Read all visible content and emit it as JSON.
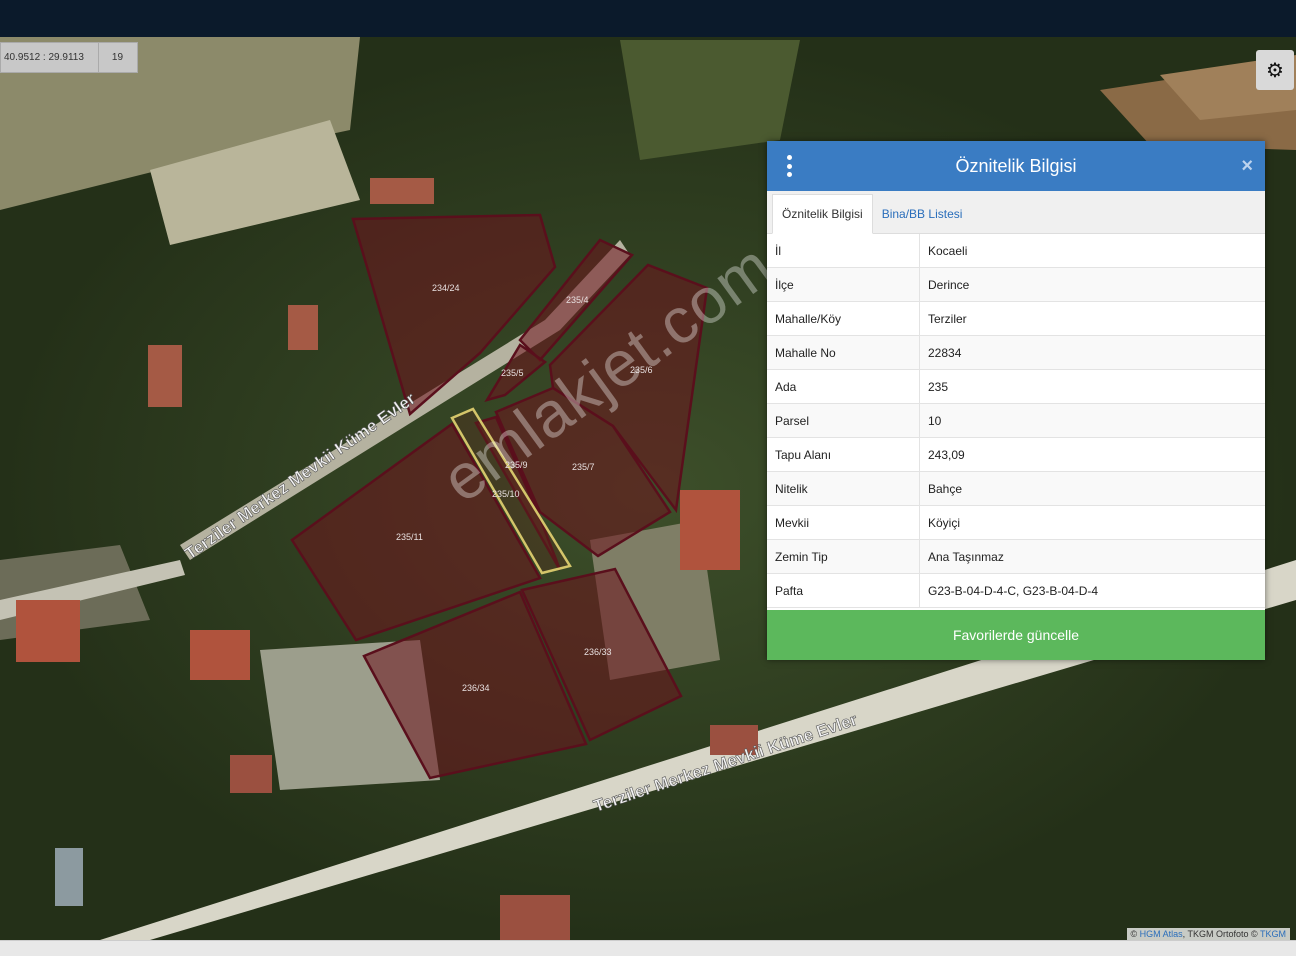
{
  "map": {
    "coordinates": "40.9512 : 29.9113",
    "zoom": "19",
    "settings_icon": "gear-icon",
    "road_labels": [
      "Terziler Merkez Mevkii Küme Evler",
      "Terziler Merkez Mevkii Küme Evler"
    ],
    "parcels": [
      "234/24",
      "235/4",
      "235/5",
      "235/6",
      "235/9",
      "235/7",
      "235/10",
      "235/11",
      "236/33",
      "236/34"
    ],
    "attribution": {
      "prefix": "©",
      "hgm": "HGM Atlas",
      "mid": ", TKGM Ortofoto ©",
      "tkgm": "TKGM"
    },
    "watermark": "emlakjet.com"
  },
  "panel": {
    "title": "Öznitelik Bilgisi",
    "menu_icon": "vertical-dots-icon",
    "close_icon": "close-icon",
    "tabs": [
      {
        "label": "Öznitelik Bilgisi",
        "active": true
      },
      {
        "label": "Bina/BB Listesi",
        "active": false
      }
    ],
    "rows": [
      {
        "key": "İl",
        "value": "Kocaeli"
      },
      {
        "key": "İlçe",
        "value": "Derince"
      },
      {
        "key": "Mahalle/Köy",
        "value": "Terziler"
      },
      {
        "key": "Mahalle No",
        "value": "22834"
      },
      {
        "key": "Ada",
        "value": "235"
      },
      {
        "key": "Parsel",
        "value": "10"
      },
      {
        "key": "Tapu Alanı",
        "value": "243,09"
      },
      {
        "key": "Nitelik",
        "value": "Bahçe"
      },
      {
        "key": "Mevkii",
        "value": "Köyiçi"
      },
      {
        "key": "Zemin Tip",
        "value": "Ana Taşınmaz"
      },
      {
        "key": "Pafta",
        "value": "G23-B-04-D-4-C, G23-B-04-D-4"
      }
    ],
    "button_label": "Favorilerde güncelle"
  },
  "colors": {
    "header": "#3a7cc3",
    "button": "#5cb85c",
    "parcel_stroke": "#5a0f1c",
    "selected_stroke": "#d4c56a"
  }
}
